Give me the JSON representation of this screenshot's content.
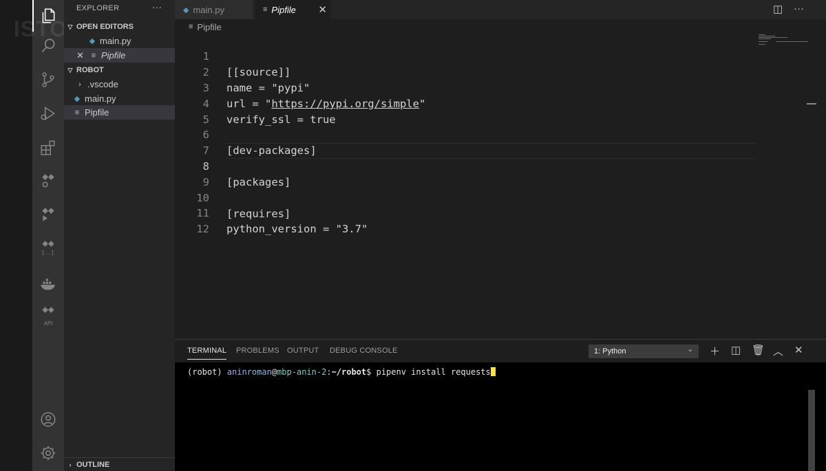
{
  "watermark": "ISTORIES",
  "sidebar": {
    "title": "EXPLORER",
    "more": "···",
    "open_editors": {
      "header": "OPEN EDITORS",
      "items": [
        {
          "label": "main.py"
        },
        {
          "label": "Pipfile"
        }
      ]
    },
    "folder": {
      "header": "ROBOT",
      "items": [
        {
          "label": ".vscode"
        },
        {
          "label": "main.py"
        },
        {
          "label": "Pipfile"
        }
      ]
    },
    "outline": "OUTLINE"
  },
  "tabs": [
    {
      "label": "main.py"
    },
    {
      "label": "Pipfile"
    }
  ],
  "breadcrumb": "Pipfile",
  "editor": {
    "lines": [
      {
        "num": "1",
        "text": "[[source]]"
      },
      {
        "num": "2",
        "text": "name = \"pypi\""
      },
      {
        "num": "3",
        "pre": "url = \"",
        "link": "https://pypi.org/simple",
        "post": "\""
      },
      {
        "num": "4",
        "text": "verify_ssl = true"
      },
      {
        "num": "5",
        "text": ""
      },
      {
        "num": "6",
        "text": "[dev-packages]"
      },
      {
        "num": "7",
        "text": ""
      },
      {
        "num": "8",
        "text": "[packages]"
      },
      {
        "num": "9",
        "text": ""
      },
      {
        "num": "10",
        "text": "[requires]"
      },
      {
        "num": "11",
        "text": "python_version = \"3.7\""
      },
      {
        "num": "12",
        "text": ""
      }
    ],
    "current_line": 8
  },
  "panel": {
    "tabs": [
      "TERMINAL",
      "PROBLEMS",
      "OUTPUT",
      "DEBUG CONSOLE"
    ],
    "active_tab": "TERMINAL",
    "terminal_select": "1: Python",
    "terminal": {
      "env": "(robot)",
      "user": "aninroman",
      "at": "@",
      "host": "mbp-anin-2",
      "colon": ":",
      "path": "~/robot",
      "prompt": "$ ",
      "command": "pipenv install requests"
    }
  },
  "icons": [
    "files-icon",
    "search-icon",
    "source-control-icon",
    "run-debug-icon",
    "extensions-icon",
    "remote-explorer-icon",
    "test-icon",
    "json-icon",
    "docker-icon",
    "api-icon",
    "account-icon",
    "settings-gear-icon"
  ],
  "colors": {
    "activity_bar": "#333333",
    "sidebar": "#252526",
    "editor": "#1e1e1e",
    "terminal": "#000000",
    "cursor": "#ffe04a",
    "python_icon": "#519aba"
  }
}
